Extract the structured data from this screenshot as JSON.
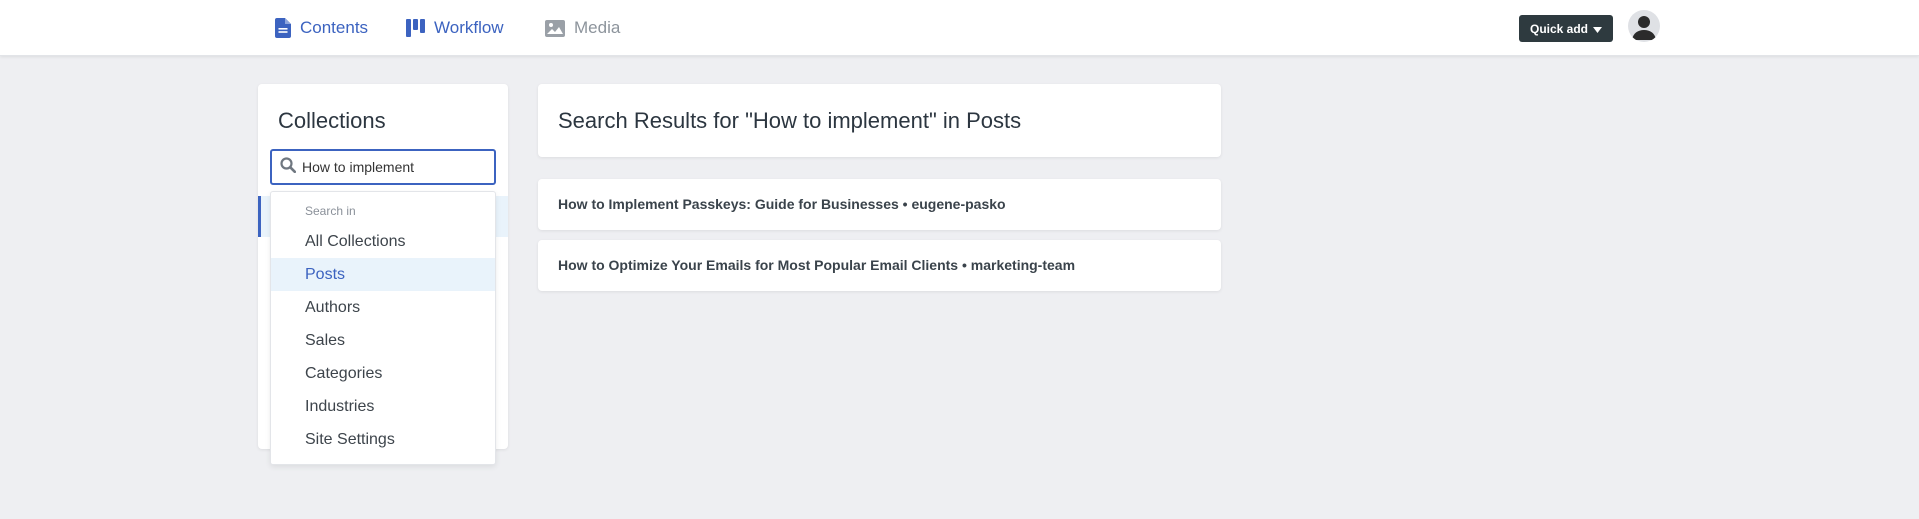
{
  "nav": {
    "contents_label": "Contents",
    "workflow_label": "Workflow",
    "media_label": "Media",
    "quick_add_label": "Quick add"
  },
  "colors": {
    "accent": "#3c63c0",
    "topbar_bg": "#ffffff",
    "page_bg": "#eeeff2",
    "quick_add_bg": "#2e3a3f",
    "selected_bg": "#e9f3fb",
    "muted": "#8d949c"
  },
  "icons": {
    "contents": "document-icon",
    "workflow": "kanban-icon",
    "media": "image-icon",
    "quick_add": "caret-down-icon",
    "avatar": "user-avatar-icon",
    "search": "search-icon"
  },
  "sidebar": {
    "title": "Collections",
    "search": {
      "value": "How to implement",
      "placeholder": ""
    }
  },
  "dropdown": {
    "header": "Search in",
    "items": [
      {
        "label": "All Collections",
        "active": false
      },
      {
        "label": "Posts",
        "active": true
      },
      {
        "label": "Authors",
        "active": false
      },
      {
        "label": "Sales",
        "active": false
      },
      {
        "label": "Categories",
        "active": false
      },
      {
        "label": "Industries",
        "active": false
      },
      {
        "label": "Site Settings",
        "active": false
      }
    ]
  },
  "results": {
    "title": "Search Results for \"How to implement\" in Posts",
    "items": [
      {
        "text": "How to Implement Passkeys: Guide for Businesses • eugene-pasko"
      },
      {
        "text": "How to Optimize Your Emails for Most Popular Email Clients • marketing-team"
      }
    ]
  }
}
